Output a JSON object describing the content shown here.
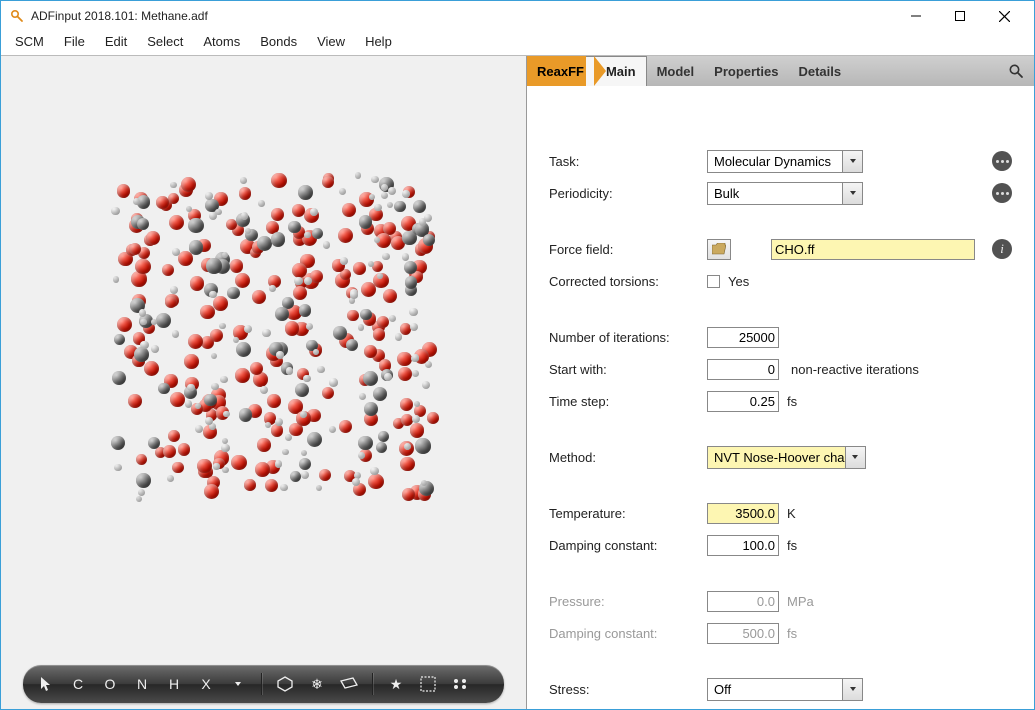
{
  "title": "ADFinput 2018.101: Methane.adf",
  "menus": [
    "SCM",
    "File",
    "Edit",
    "Select",
    "Atoms",
    "Bonds",
    "View",
    "Help"
  ],
  "tabs": {
    "engine": "ReaxFF",
    "active": "Main",
    "others": [
      "Model",
      "Properties",
      "Details"
    ]
  },
  "form": {
    "task": {
      "label": "Task:",
      "value": "Molecular Dynamics"
    },
    "periodicity": {
      "label": "Periodicity:",
      "value": "Bulk"
    },
    "forcefield": {
      "label": "Force field:",
      "value": "CHO.ff"
    },
    "corrected": {
      "label": "Corrected torsions:",
      "option": "Yes"
    },
    "iterations": {
      "label": "Number of iterations:",
      "value": "25000"
    },
    "startwith": {
      "label": "Start with:",
      "value": "0",
      "suffix": "non-reactive iterations"
    },
    "timestep": {
      "label": "Time step:",
      "value": "0.25",
      "unit": "fs"
    },
    "method": {
      "label": "Method:",
      "value": "NVT Nose-Hoover cha"
    },
    "temperature": {
      "label": "Temperature:",
      "value": "3500.0",
      "unit": "K"
    },
    "damping1": {
      "label": "Damping constant:",
      "value": "100.0",
      "unit": "fs"
    },
    "pressure": {
      "label": "Pressure:",
      "value": "0.0",
      "unit": "MPa"
    },
    "damping2": {
      "label": "Damping constant:",
      "value": "500.0",
      "unit": "fs"
    },
    "stress": {
      "label": "Stress:",
      "value": "Off"
    }
  },
  "toolglyphs": {
    "c": "C",
    "o": "O",
    "n": "N",
    "h": "H",
    "x": "X",
    "snow": "❄",
    "star": "★"
  }
}
